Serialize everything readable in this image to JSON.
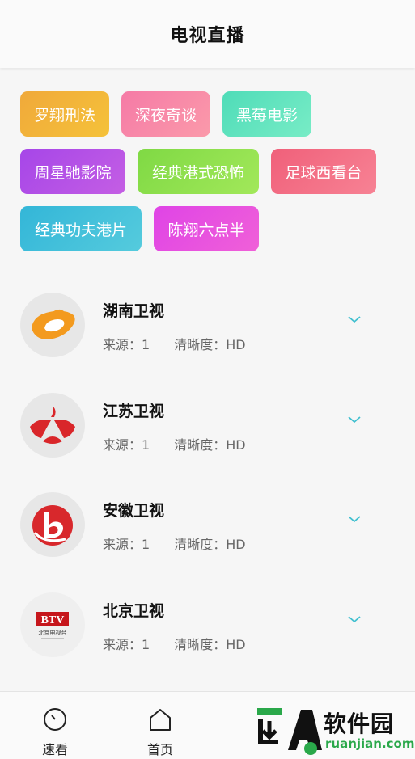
{
  "header": {
    "title": "电视直播"
  },
  "tags": [
    {
      "label": "罗翔刑法",
      "color": "#f2b531"
    },
    {
      "label": "深夜奇谈",
      "color": "#f788a8"
    },
    {
      "label": "黑莓电影",
      "color": "#5fe3be"
    },
    {
      "label": "周星驰影院",
      "color": "#b44ee6"
    },
    {
      "label": "经典港式恐怖",
      "color": "#8ee04c"
    },
    {
      "label": "足球西看台",
      "color": "#f26e84"
    },
    {
      "label": "经典功夫港片",
      "color": "#3fc0da"
    },
    {
      "label": "陈翔六点半",
      "color": "#e84ce4"
    }
  ],
  "channels": [
    {
      "name": "湖南卫视",
      "source": "来源：1",
      "quality": "清晰度：HD",
      "logo_icon": "hunan-tv-logo-icon"
    },
    {
      "name": "江苏卫视",
      "source": "来源：1",
      "quality": "清晰度：HD",
      "logo_icon": "jiangsu-tv-logo-icon"
    },
    {
      "name": "安徽卫视",
      "source": "来源：1",
      "quality": "清晰度：HD",
      "logo_icon": "anhui-tv-logo-icon"
    },
    {
      "name": "北京卫视",
      "source": "来源：1",
      "quality": "清晰度：HD",
      "logo_icon": "btv-logo-icon",
      "logo_text": "BTV",
      "logo_sub": "北京电视台"
    }
  ],
  "tabbar": {
    "items": [
      {
        "label": "速看",
        "icon": "clock-icon"
      },
      {
        "label": "首页",
        "icon": "home-icon"
      }
    ]
  },
  "watermark": {
    "text": "软件园",
    "sub": "ruanjian.com"
  },
  "colors": {
    "chevron": "#3fbfcf"
  }
}
